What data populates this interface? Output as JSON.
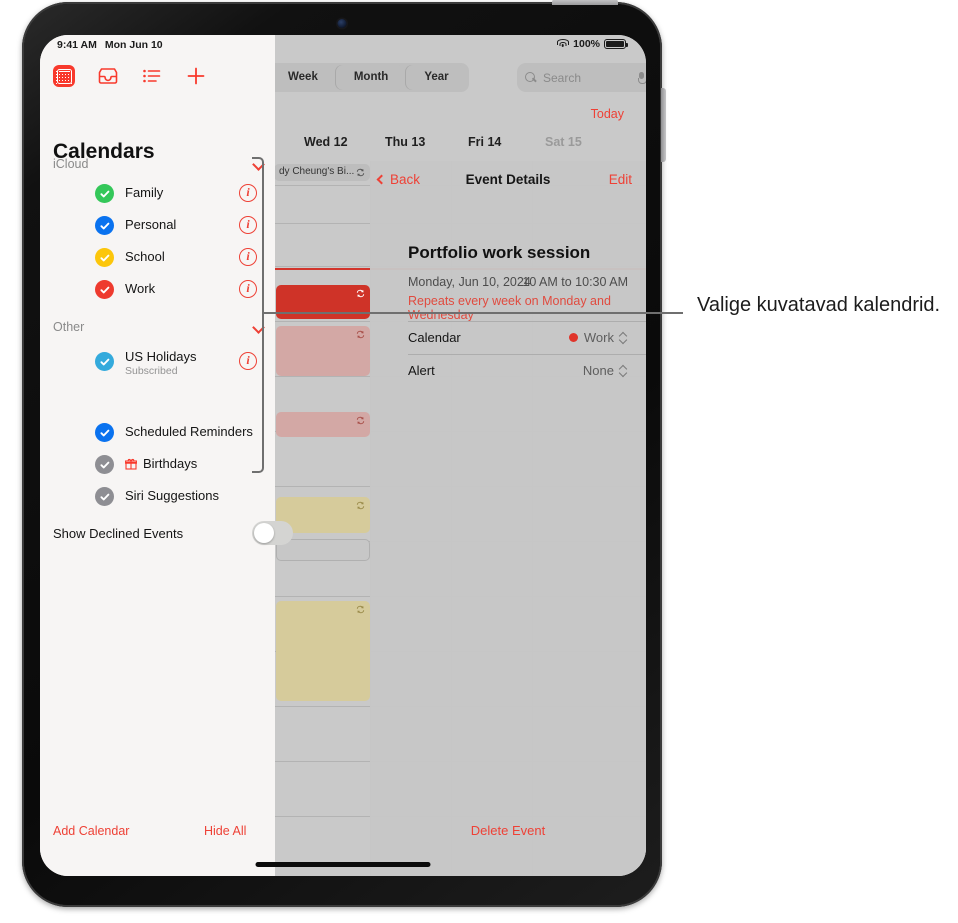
{
  "status_bar": {
    "time": "9:41 AM",
    "date": "Mon Jun 10",
    "battery": "100%",
    "wifi_icon": "wifi-icon",
    "battery_icon": "battery-icon"
  },
  "calendar_view": {
    "segments": [
      {
        "label": "Week",
        "selected": false
      },
      {
        "label": "Month",
        "selected": false
      },
      {
        "label": "Year",
        "selected": false
      }
    ],
    "search": {
      "placeholder": "Search",
      "icon": "search-icon",
      "mic_icon": "microphone-icon"
    },
    "today_label": "Today",
    "days": [
      {
        "label": "Wed 12",
        "dim": false
      },
      {
        "label": "Thu 13",
        "dim": false
      },
      {
        "label": "Fri 14",
        "dim": false
      },
      {
        "label": "Sat 15",
        "dim": true
      }
    ],
    "all_day_event": "dy Cheung's Bi...",
    "events": [
      {
        "color": "#cf3328",
        "repeat_icon": "repeat-icon"
      },
      {
        "color": "#d3a8a5",
        "repeat_icon": "repeat-icon"
      },
      {
        "color": "#d3a8a5",
        "repeat_icon": "repeat-icon"
      },
      {
        "color": "#d6cb9b",
        "repeat_icon": "repeat-icon"
      },
      {
        "color": "#d6cb9b",
        "repeat_icon": "repeat-icon"
      }
    ]
  },
  "sidebar": {
    "toolbar": [
      {
        "name": "calendars-button",
        "icon": "calendar-icon",
        "selected": true
      },
      {
        "name": "inbox-button",
        "icon": "inbox-icon",
        "selected": false
      },
      {
        "name": "list-button",
        "icon": "list-icon",
        "selected": false
      },
      {
        "name": "add-button",
        "icon": "plus-icon",
        "selected": false
      }
    ],
    "heading": "Calendars",
    "sections": [
      {
        "title": "iCloud",
        "chevron_icon": "chevron-down-icon",
        "items": [
          {
            "name": "Family",
            "color": "#34c759",
            "checked": true,
            "has_info": true
          },
          {
            "name": "Personal",
            "color": "#0a72ef",
            "checked": true,
            "has_info": true
          },
          {
            "name": "School",
            "color": "#fcc60b",
            "checked": true,
            "has_info": true
          },
          {
            "name": "Work",
            "color": "#ee3a2e",
            "checked": true,
            "has_info": true
          }
        ]
      },
      {
        "title": "Other",
        "chevron_icon": "chevron-down-icon",
        "items": [
          {
            "name": "US Holidays",
            "subtitle": "Subscribed",
            "color": "#34aadc",
            "checked": true,
            "has_info": true
          },
          {
            "name": "Scheduled Reminders",
            "color": "#0a72ef",
            "checked": true,
            "has_info": false
          },
          {
            "name": "Birthdays",
            "color": "#8e8e93",
            "checked": true,
            "has_info": false,
            "leading_icon": "gift-icon"
          },
          {
            "name": "Siri Suggestions",
            "color": "#8e8e93",
            "checked": true,
            "has_info": false
          }
        ]
      }
    ],
    "show_declined_label": "Show Declined Events",
    "show_declined_on": false,
    "add_calendar_label": "Add Calendar",
    "hide_all_label": "Hide All"
  },
  "event_details": {
    "back_label": "Back",
    "title_label": "Event Details",
    "edit_label": "Edit",
    "event_title": "Portfolio work session",
    "event_date": "Monday, Jun 10, 2024",
    "event_time": "10 AM to 10:30 AM",
    "repeat_text": "Repeats every week on Monday and Wednesday",
    "rows": [
      {
        "label": "Calendar",
        "value": "Work",
        "dot_color": "#e0342a",
        "stepper_icon": "up-down-chevron-icon"
      },
      {
        "label": "Alert",
        "value": "None",
        "dot_color": null,
        "stepper_icon": "up-down-chevron-icon"
      }
    ],
    "delete_label": "Delete Event"
  },
  "annotation": {
    "text": "Valige kuvatavad kalendrid."
  },
  "colors": {
    "accent_red": "#ee4136",
    "sidebar_bg": "#f7f5f4",
    "calendar_bg": "#c9c9c9",
    "callout": "#6f6f6f"
  }
}
